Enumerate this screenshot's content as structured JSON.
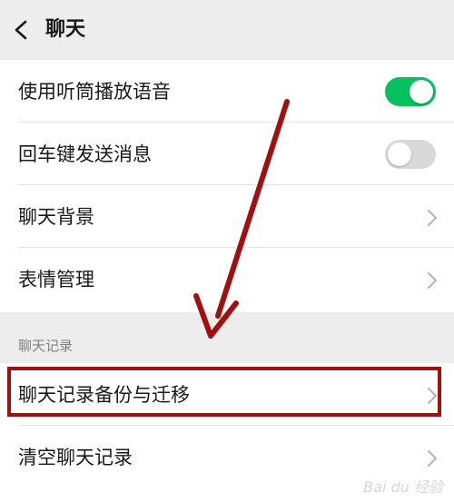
{
  "header": {
    "title": "聊天",
    "back_icon": "chevron-left-icon"
  },
  "settings": {
    "items": [
      {
        "label": "使用听筒播放语音",
        "control": "toggle",
        "state": "on"
      },
      {
        "label": "回车键发送消息",
        "control": "toggle",
        "state": "off"
      },
      {
        "label": "聊天背景",
        "control": "chevron"
      },
      {
        "label": "表情管理",
        "control": "chevron"
      }
    ]
  },
  "chat_history": {
    "section_title": "聊天记录",
    "items": [
      {
        "label": "聊天记录备份与迁移",
        "control": "chevron",
        "highlighted": true
      },
      {
        "label": "清空聊天记录",
        "control": "chevron"
      }
    ]
  },
  "colors": {
    "toggle_on": "#07c160",
    "toggle_off": "#d9d9d9",
    "annotation_red": "#a01010"
  },
  "watermark": "Bai du 经验"
}
